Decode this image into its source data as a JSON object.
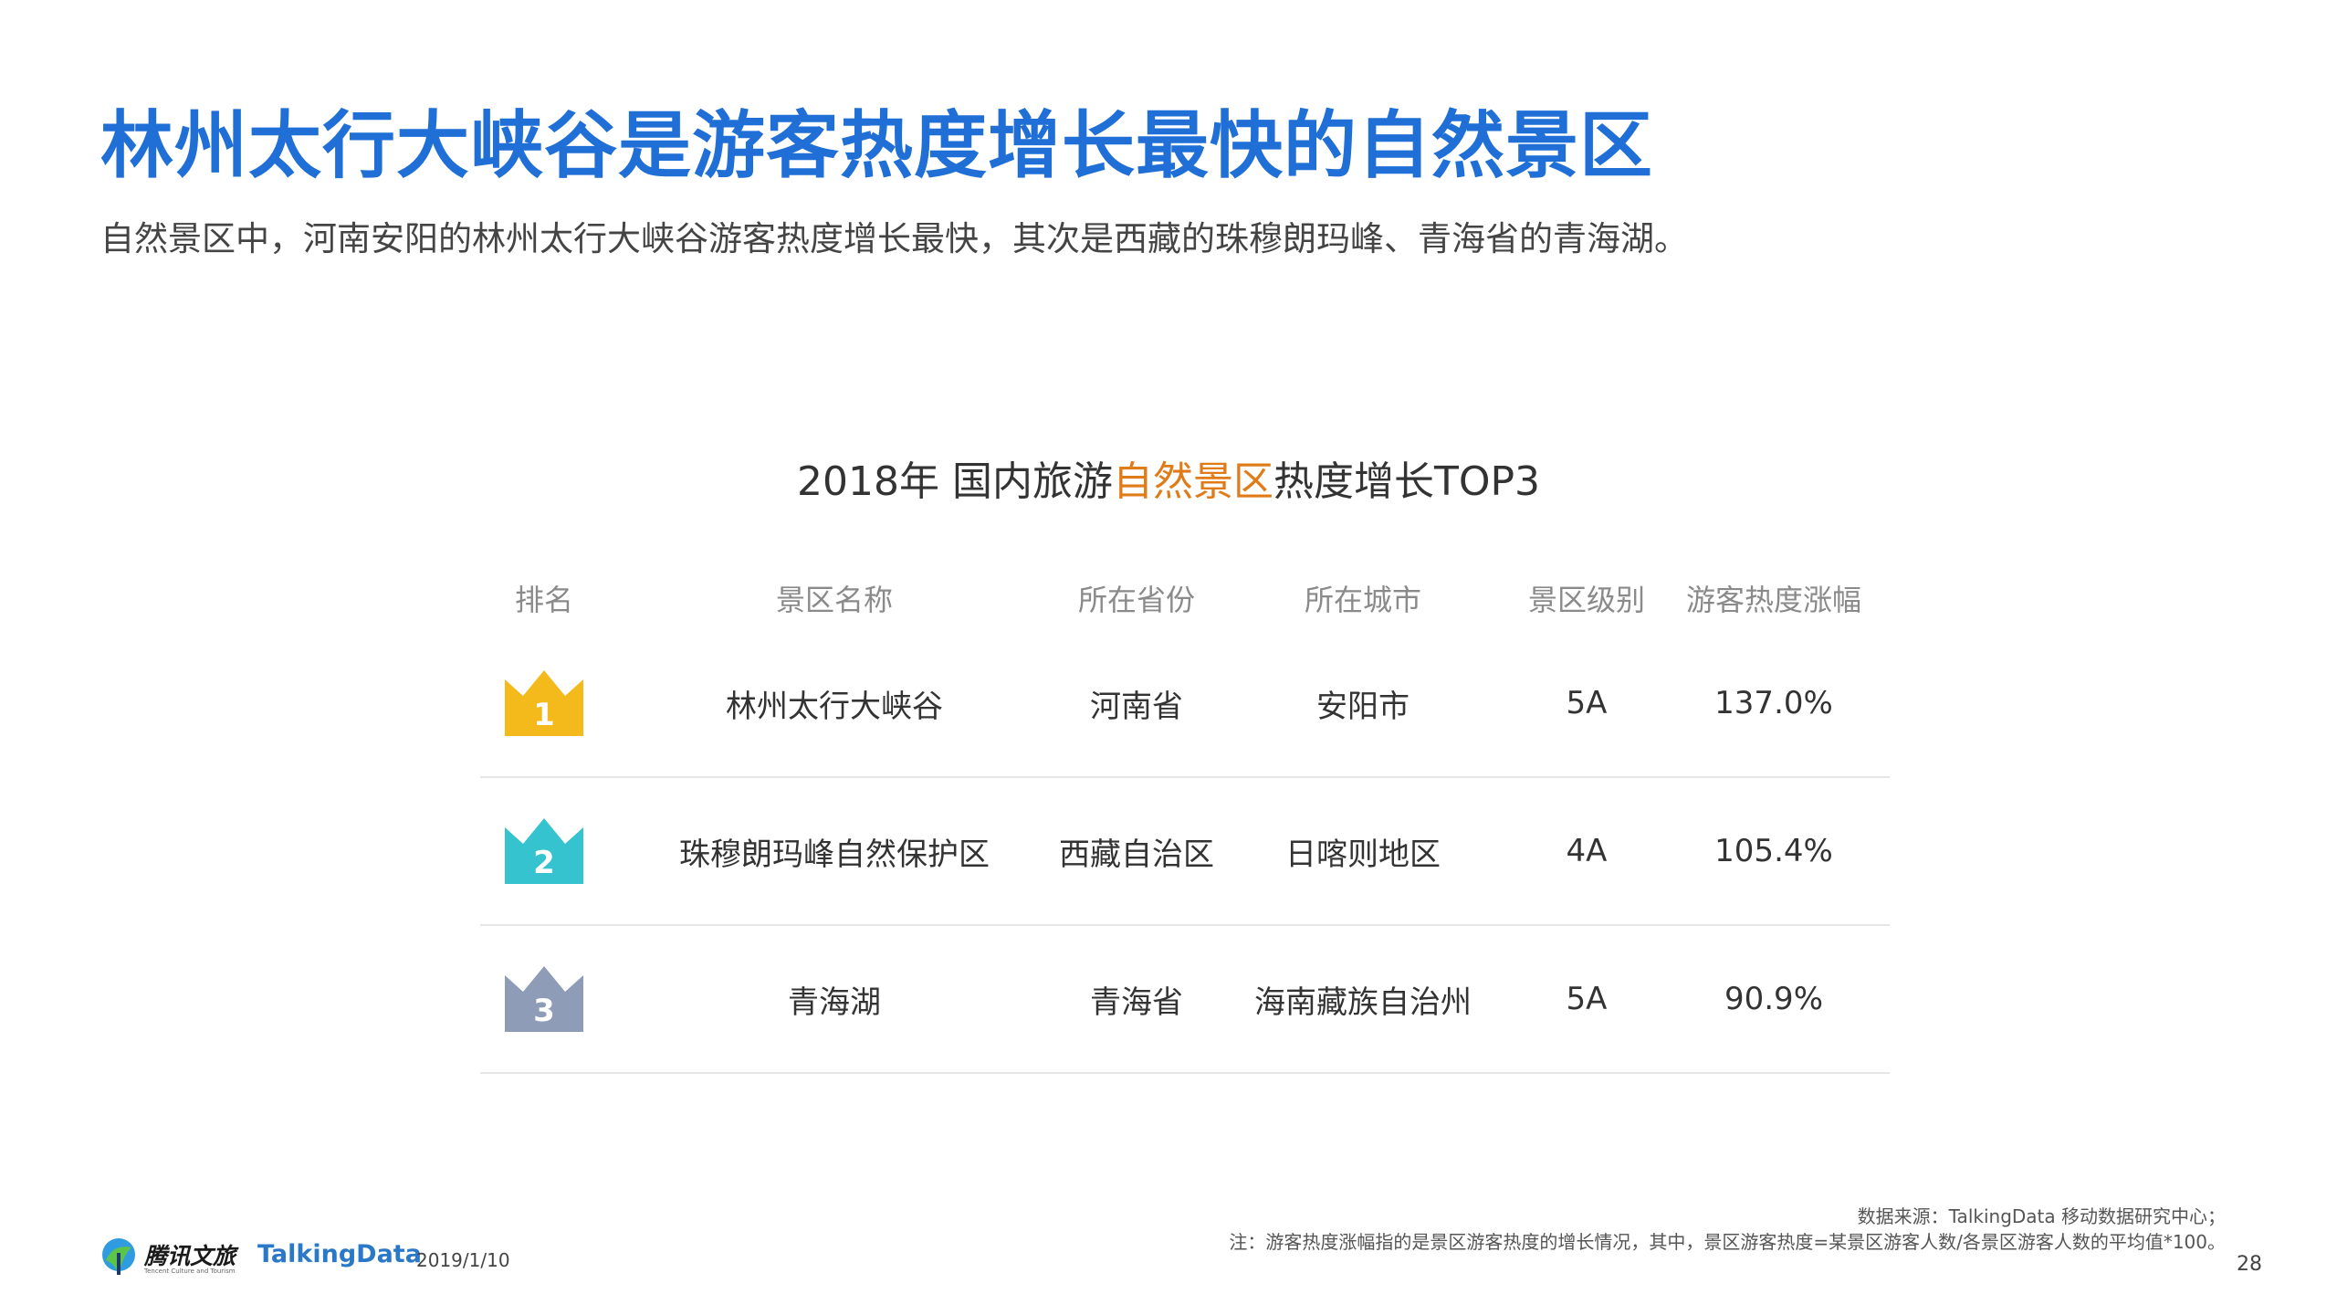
{
  "headline": "林州太行大峡谷是游客热度增长最快的自然景区",
  "subtitle": "自然景区中，河南安阳的林州太行大峡谷游客热度增长最快，其次是西藏的珠穆朗玛峰、青海省的青海湖。",
  "table": {
    "title_before": "2018年 国内旅游",
    "title_highlight": "自然景区",
    "title_after": "热度增长TOP3",
    "highlight_color": "#e07b1a",
    "headers": [
      "排名",
      "景区名称",
      "所在省份",
      "所在城市",
      "景区级别",
      "游客热度涨幅"
    ],
    "rows": [
      {
        "rank": "1",
        "crown_color": "#f4b91a",
        "name": "林州太行大峡谷",
        "province": "河南省",
        "city": "安阳市",
        "level": "5A",
        "growth": "137.0%"
      },
      {
        "rank": "2",
        "crown_color": "#35c4cf",
        "name": "珠穆朗玛峰自然保护区",
        "province": "西藏自治区",
        "city": "日喀则地区",
        "level": "4A",
        "growth": "105.4%"
      },
      {
        "rank": "3",
        "crown_color": "#8f9cb8",
        "name": "青海湖",
        "province": "青海省",
        "city": "海南藏族自治州",
        "level": "5A",
        "growth": "90.9%"
      }
    ]
  },
  "footer": {
    "brand1": "腾讯文旅",
    "brand1_sub": "Tencent Culture and Tourism",
    "brand2": "TalkingData",
    "date": "2019/1/10",
    "source": "数据来源：TalkingData 移动数据研究中心；",
    "note": "注：游客热度涨幅指的是景区游客热度的增长情况，其中，景区游客热度=某景区游客人数/各景区游客人数的平均值*100。",
    "page_number": "28"
  }
}
